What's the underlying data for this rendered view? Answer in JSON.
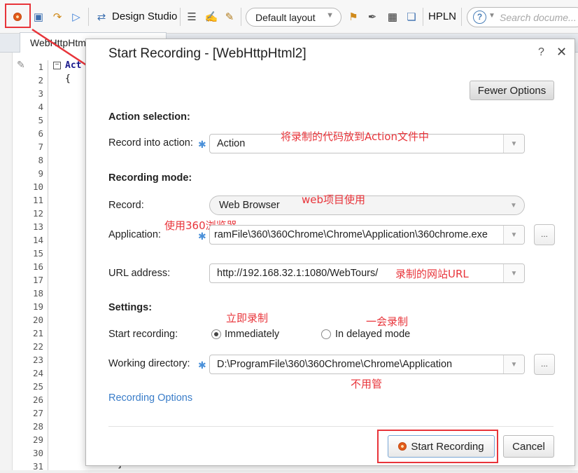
{
  "toolbar": {
    "design_studio": "Design Studio",
    "layout_select": "Default layout",
    "hpln": "HPLN",
    "search_placeholder": "Search docume..."
  },
  "editor": {
    "tab_title": "WebHttpHtml",
    "line_numbers": [
      "1",
      "2",
      "3",
      "4",
      "5",
      "6",
      "7",
      "8",
      "9",
      "10",
      "11",
      "12",
      "13",
      "14",
      "15",
      "16",
      "17",
      "18",
      "19",
      "20",
      "21",
      "22",
      "23",
      "24",
      "25",
      "26",
      "27",
      "28",
      "29",
      "30",
      "31"
    ],
    "code_line1": "Act",
    "code_line2": "{",
    "code_bottom": "}"
  },
  "dialog": {
    "title": "Start Recording - [WebHttpHtml2]",
    "help": "?",
    "close": "✕",
    "fewer_options": "Fewer Options",
    "action_selection": {
      "heading": "Action selection:",
      "record_into_label": "Record into action:",
      "record_into_value": "Action"
    },
    "recording_mode": {
      "heading": "Recording mode:",
      "record_label": "Record:",
      "record_value": "Web Browser",
      "application_label": "Application:",
      "application_value": "ramFile\\360\\360Chrome\\Chrome\\Application\\360chrome.exe",
      "url_label": "URL address:",
      "url_value": "http://192.168.32.1:1080/WebTours/"
    },
    "settings": {
      "heading": "Settings:",
      "start_label": "Start recording:",
      "immediately": "Immediately",
      "delayed": "In delayed mode",
      "workdir_label": "Working directory:",
      "workdir_value": "D:\\ProgramFile\\360\\360Chrome\\Chrome\\Application"
    },
    "browse": "...",
    "recording_options": "Recording Options",
    "start_recording": "Start Recording",
    "cancel": "Cancel"
  },
  "annotations": {
    "action": "将录制的代码放到Action文件中",
    "web": "web项目使用",
    "browser": "使用360浏览器",
    "url": "录制的网站URL",
    "immediate": "立即录制",
    "delayed": "一会录制",
    "workdir": "不用管"
  },
  "colors": {
    "annotation_red": "#e8343a",
    "link_blue": "#3a7dc9",
    "required_star": "#4a90d9"
  }
}
